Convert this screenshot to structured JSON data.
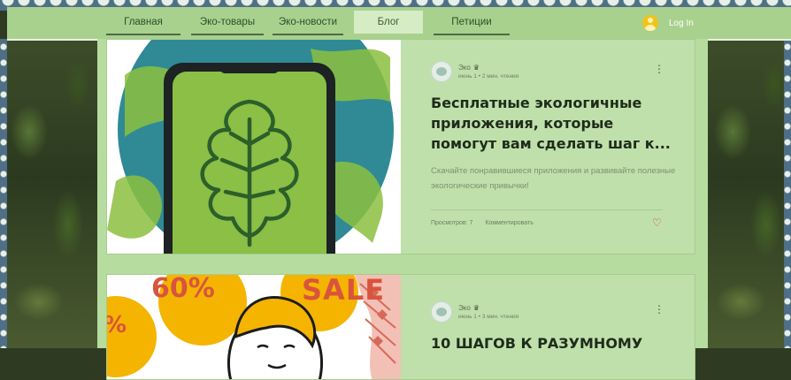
{
  "nav": {
    "items": [
      {
        "label": "Главная"
      },
      {
        "label": "Эко-товары"
      },
      {
        "label": "Эко-новости"
      },
      {
        "label": "Блог"
      },
      {
        "label": "Петиции"
      }
    ],
    "active": "Блог",
    "login_label": "Log In"
  },
  "posts": [
    {
      "author": "Эко",
      "date": "июнь 1",
      "read_time": "2 мин. чтения",
      "title": "Бесплатные экологичные приложения, которые помогут вам сделать шаг к...",
      "excerpt": "Скачайте понравившиеся приложения и развивайте полезные экологические привычки!",
      "views": "Просмотров: 7",
      "comment_label": "Комментировать"
    },
    {
      "author": "Эко",
      "date": "июнь 1",
      "read_time": "3 мин. чтения",
      "title": "10 ШАГОВ К РАЗУМНОМУ",
      "image_text": [
        "60%",
        "SALE",
        "%"
      ]
    }
  ],
  "colors": {
    "nav_bg": "#a9d18e",
    "card_bg": "#bfe0ab",
    "like": "#e0405a",
    "login_icon": "#f2c318"
  },
  "icons": [
    "user-circle-icon",
    "crown-icon",
    "more-vertical-icon",
    "heart-icon",
    "leaf-icon"
  ]
}
